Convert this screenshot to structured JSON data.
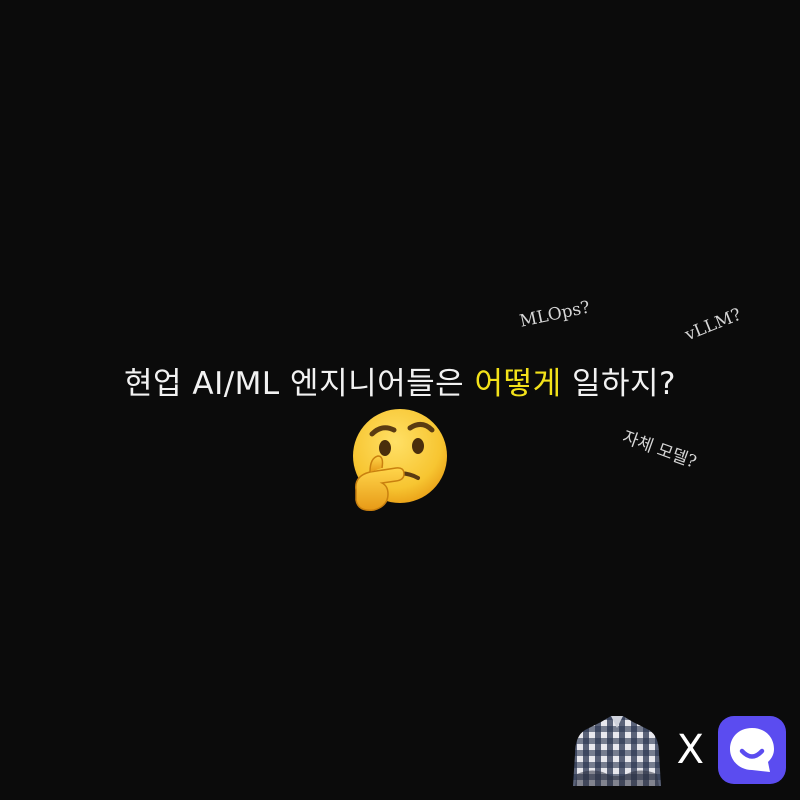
{
  "headline": {
    "prefix": "현업 AI/ML 엔지니어들은 ",
    "highlight": "어떻게",
    "suffix": " 일하지?",
    "highlight_color": "#f3e21a"
  },
  "tags": {
    "mlops": "MLOps?",
    "vllm": "vLLM?",
    "own_model": "자체 모델?"
  },
  "emoji": "thinking-face-icon",
  "footer": {
    "cross": "X",
    "person": "person-plaid-shirt-icon",
    "brand": "chat-bubble-logo-icon",
    "brand_color": "#5b4cf0"
  }
}
